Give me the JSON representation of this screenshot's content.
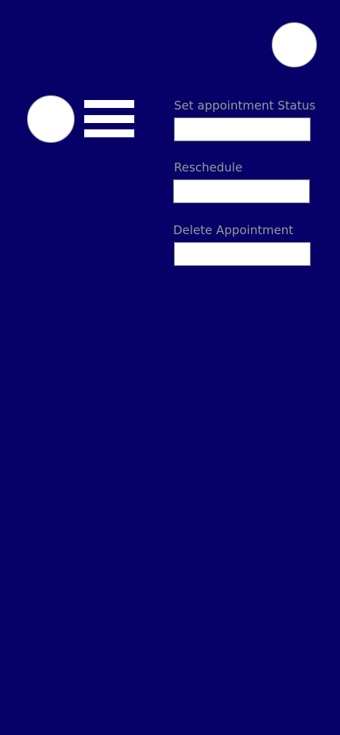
{
  "header": {
    "profile_icon": "profile-circle-icon"
  },
  "sidebar": {
    "avatar_icon": "avatar-circle-icon",
    "menu_icon": "hamburger-menu-icon"
  },
  "form": {
    "status": {
      "label": "Set appointment Status",
      "value": ""
    },
    "reschedule": {
      "label": "Reschedule",
      "value": ""
    },
    "delete": {
      "label": "Delete Appointment",
      "value": ""
    }
  },
  "colors": {
    "background": "#060068",
    "label_text": "#9a9a9a",
    "field_fill": "#ffffff",
    "icon_fill": "#ffffff"
  }
}
